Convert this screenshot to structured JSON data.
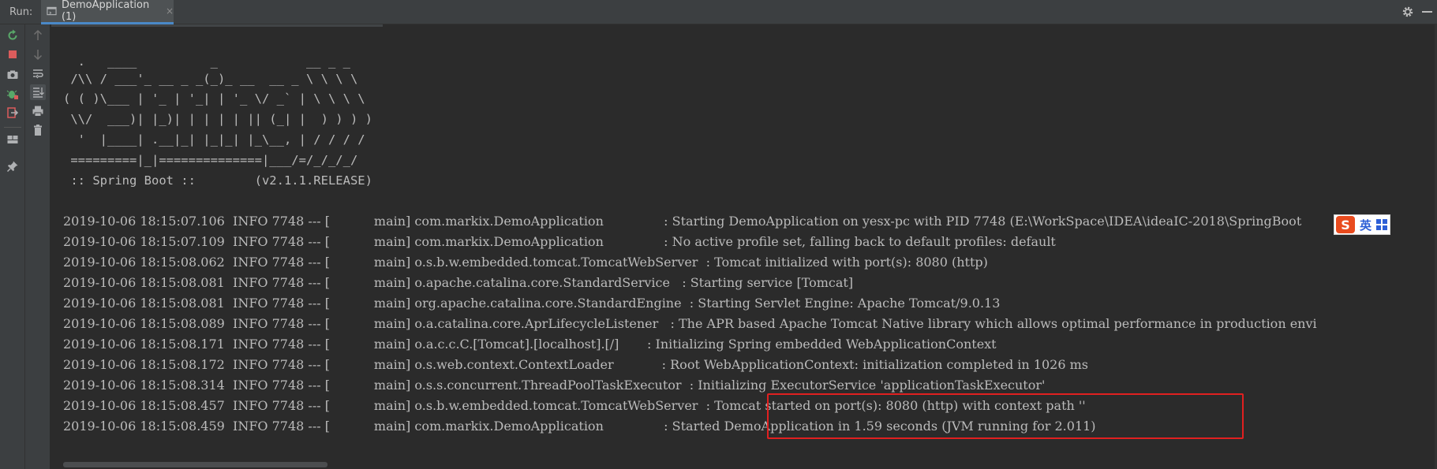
{
  "header": {
    "run_label": "Run:",
    "tab_title": "DemoApplication (1)",
    "tab_close": "×"
  },
  "toolbar": {
    "left": [
      "rerun-icon",
      "stop-icon",
      "camera-icon",
      "debug-icon",
      "exit-icon",
      "layout-icon",
      "pin-icon"
    ],
    "mid": [
      "up-arrow-icon",
      "down-arrow-icon",
      "soft-wrap-icon",
      "scroll-to-end-icon",
      "print-icon",
      "trash-icon"
    ]
  },
  "banner": [
    "  .   ____          _            __ _ _",
    " /\\\\ / ___'_ __ _ _(_)_ __  __ _ \\ \\ \\ \\",
    "( ( )\\___ | '_ | '_| | '_ \\/ _` | \\ \\ \\ \\",
    " \\\\/  ___)| |_)| | | | | || (_| |  ) ) ) )",
    "  '  |____| .__|_| |_|_| |_\\__, | / / / /",
    " =========|_|==============|___/=/_/_/_/",
    " :: Spring Boot ::        (v2.1.1.RELEASE)"
  ],
  "logs": [
    "2019-10-06 18:15:07.106  INFO 7748 --- [           main] com.markix.DemoApplication               : Starting DemoApplication on yesx-pc with PID 7748 (E:\\WorkSpace\\IDEA\\ideaIC-2018\\SpringBoot",
    "2019-10-06 18:15:07.109  INFO 7748 --- [           main] com.markix.DemoApplication               : No active profile set, falling back to default profiles: default",
    "2019-10-06 18:15:08.062  INFO 7748 --- [           main] o.s.b.w.embedded.tomcat.TomcatWebServer  : Tomcat initialized with port(s): 8080 (http)",
    "2019-10-06 18:15:08.081  INFO 7748 --- [           main] o.apache.catalina.core.StandardService   : Starting service [Tomcat]",
    "2019-10-06 18:15:08.081  INFO 7748 --- [           main] org.apache.catalina.core.StandardEngine  : Starting Servlet Engine: Apache Tomcat/9.0.13",
    "2019-10-06 18:15:08.089  INFO 7748 --- [           main] o.a.catalina.core.AprLifecycleListener   : The APR based Apache Tomcat Native library which allows optimal performance in production envi",
    "2019-10-06 18:15:08.171  INFO 7748 --- [           main] o.a.c.c.C.[Tomcat].[localhost].[/]       : Initializing Spring embedded WebApplicationContext",
    "2019-10-06 18:15:08.172  INFO 7748 --- [           main] o.s.web.context.ContextLoader            : Root WebApplicationContext: initialization completed in 1026 ms",
    "2019-10-06 18:15:08.314  INFO 7748 --- [           main] o.s.s.concurrent.ThreadPoolTaskExecutor  : Initializing ExecutorService 'applicationTaskExecutor'",
    "2019-10-06 18:15:08.457  INFO 7748 --- [           main] o.s.b.w.embedded.tomcat.TomcatWebServer  : Tomcat started on port(s): 8080 (http) with context path ''",
    "2019-10-06 18:15:08.459  INFO 7748 --- [           main] com.markix.DemoApplication               : Started DemoApplication in 1.59 seconds (JVM running for 2.011)"
  ],
  "ime": {
    "logo": "S",
    "text": "英"
  },
  "colors": {
    "background": "#2b2b2b",
    "toolbar": "#3c3f41",
    "text": "#bbbbbb",
    "highlight": "#e02020",
    "run_green": "#59a869",
    "stop_red": "#db5c5c"
  }
}
